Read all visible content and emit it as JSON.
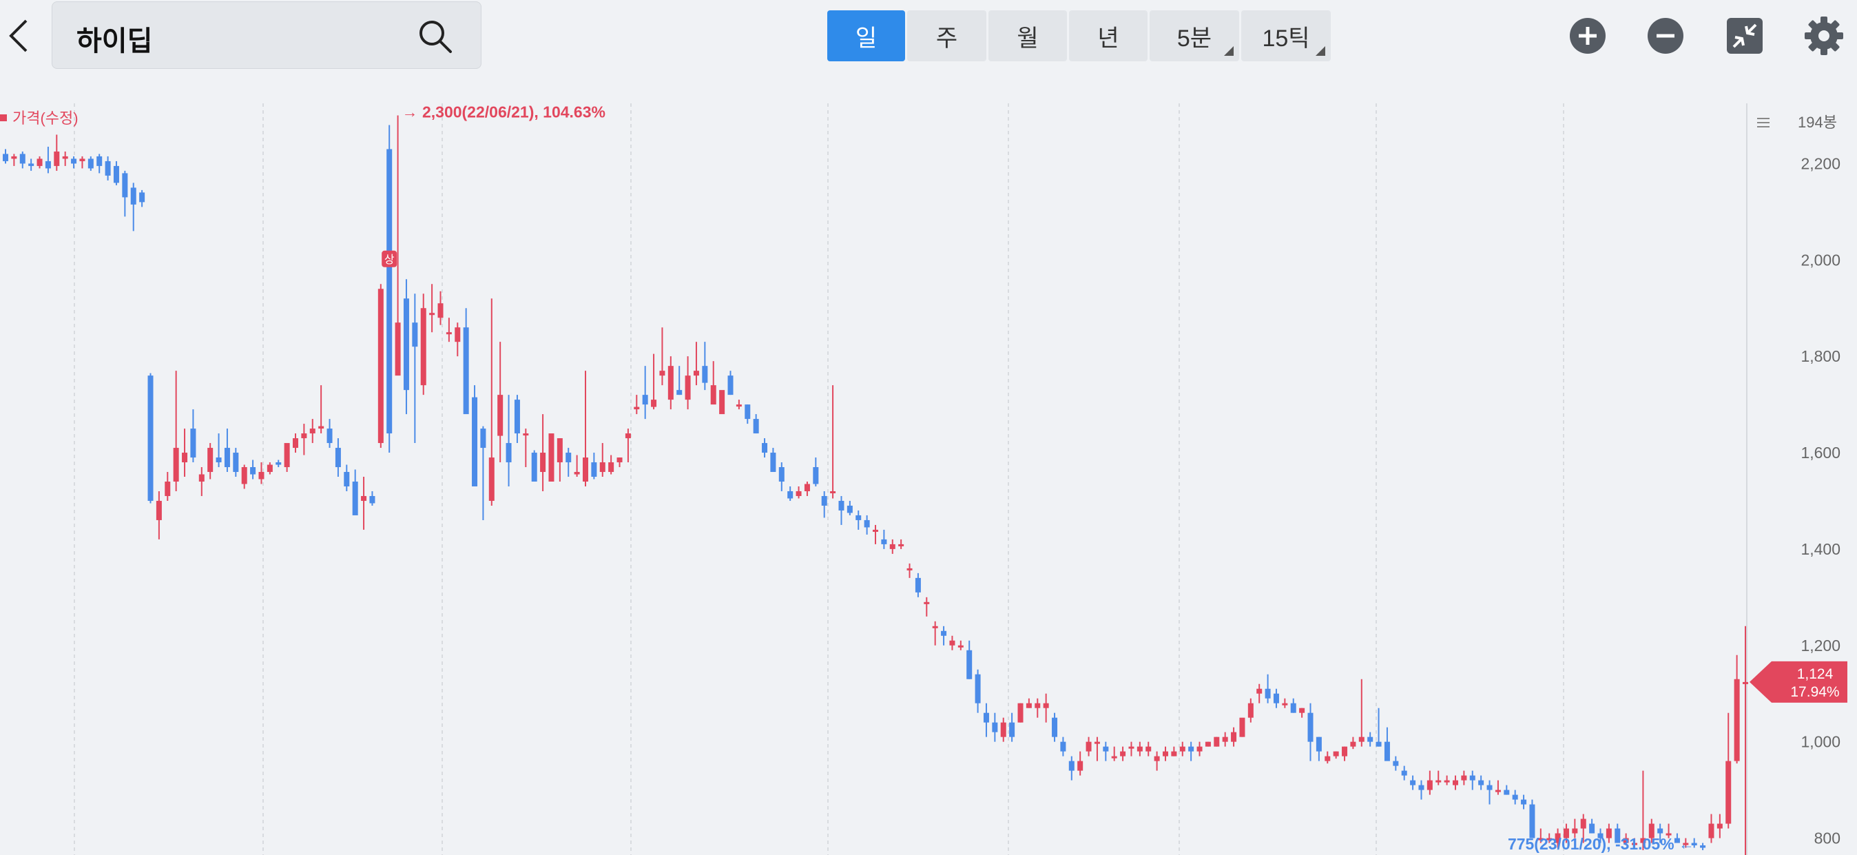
{
  "header": {
    "title": "하이딥",
    "tabs": [
      {
        "label": "일",
        "active": true,
        "dropdown": false
      },
      {
        "label": "주",
        "active": false,
        "dropdown": false
      },
      {
        "label": "월",
        "active": false,
        "dropdown": false
      },
      {
        "label": "년",
        "active": false,
        "dropdown": false
      },
      {
        "label": "5분",
        "active": false,
        "dropdown": true
      },
      {
        "label": "15틱",
        "active": false,
        "dropdown": true
      }
    ],
    "icons": [
      "chevron-left-icon",
      "search-icon",
      "zoom-in-icon",
      "zoom-out-icon",
      "collapse-icon",
      "gear-icon"
    ]
  },
  "colors": {
    "up": "#e2475d",
    "down": "#4b8be8",
    "accent": "#2f8bea"
  },
  "chart_data": {
    "type": "candlestick",
    "legend": "가격(수정)",
    "bar_count_label": "194봉",
    "y_ticks": [
      800,
      1000,
      1200,
      1400,
      1600,
      1800,
      2000,
      2200
    ],
    "ylim": [
      765,
      2325
    ],
    "grid": "vertical-dashed",
    "high_annotation": "→ 2,300(22/06/21), 104.63%",
    "low_annotation": "775(23/01/20), -31.05% ←",
    "upper_limit_badge": "상",
    "current_price": {
      "value": 1124,
      "label": "1,124",
      "change": "17.94%"
    },
    "candles": [
      [
        2220,
        2230,
        2200,
        2205
      ],
      [
        2210,
        2220,
        2195,
        2215
      ],
      [
        2220,
        2225,
        2190,
        2200
      ],
      [
        2200,
        2210,
        2185,
        2195
      ],
      [
        2195,
        2215,
        2190,
        2210
      ],
      [
        2205,
        2235,
        2180,
        2190
      ],
      [
        2195,
        2260,
        2185,
        2225
      ],
      [
        2210,
        2225,
        2195,
        2215
      ],
      [
        2210,
        2215,
        2190,
        2200
      ],
      [
        2205,
        2215,
        2190,
        2210
      ],
      [
        2210,
        2215,
        2185,
        2190
      ],
      [
        2215,
        2220,
        2180,
        2195
      ],
      [
        2205,
        2215,
        2165,
        2175
      ],
      [
        2195,
        2205,
        2155,
        2160
      ],
      [
        2180,
        2185,
        2090,
        2130
      ],
      [
        2150,
        2160,
        2060,
        2115
      ],
      [
        2140,
        2145,
        2110,
        2120
      ],
      [
        1760,
        1765,
        1495,
        1500
      ],
      [
        1460,
        1520,
        1420,
        1500
      ],
      [
        1510,
        1560,
        1500,
        1540
      ],
      [
        1540,
        1770,
        1520,
        1610
      ],
      [
        1580,
        1650,
        1550,
        1600
      ],
      [
        1650,
        1690,
        1580,
        1590
      ],
      [
        1540,
        1570,
        1510,
        1555
      ],
      [
        1560,
        1620,
        1545,
        1610
      ],
      [
        1590,
        1640,
        1570,
        1580
      ],
      [
        1610,
        1650,
        1560,
        1570
      ],
      [
        1600,
        1610,
        1550,
        1560
      ],
      [
        1535,
        1575,
        1525,
        1570
      ],
      [
        1570,
        1585,
        1545,
        1555
      ],
      [
        1545,
        1580,
        1535,
        1560
      ],
      [
        1560,
        1580,
        1555,
        1575
      ],
      [
        1580,
        1585,
        1570,
        1575
      ],
      [
        1570,
        1600,
        1560,
        1620
      ],
      [
        1610,
        1640,
        1600,
        1630
      ],
      [
        1630,
        1660,
        1595,
        1640
      ],
      [
        1640,
        1670,
        1620,
        1650
      ],
      [
        1650,
        1740,
        1640,
        1655
      ],
      [
        1650,
        1670,
        1610,
        1620
      ],
      [
        1610,
        1630,
        1550,
        1570
      ],
      [
        1560,
        1575,
        1520,
        1530
      ],
      [
        1540,
        1565,
        1490,
        1470
      ],
      [
        1500,
        1550,
        1440,
        1510
      ],
      [
        1510,
        1520,
        1490,
        1495
      ],
      [
        1620,
        1950,
        1610,
        1940
      ],
      [
        2230,
        2280,
        1600,
        1640
      ],
      [
        1760,
        2300,
        1780,
        1870
      ],
      [
        1920,
        1960,
        1680,
        1730
      ],
      [
        1870,
        1930,
        1620,
        1820
      ],
      [
        1740,
        1930,
        1720,
        1900
      ],
      [
        1890,
        1950,
        1850,
        1890
      ],
      [
        1880,
        1935,
        1865,
        1910
      ],
      [
        1850,
        1880,
        1830,
        1850
      ],
      [
        1830,
        1870,
        1800,
        1860
      ],
      [
        1860,
        1900,
        1690,
        1680
      ],
      [
        1715,
        1740,
        1530,
        1530
      ],
      [
        1650,
        1655,
        1460,
        1610
      ],
      [
        1500,
        1920,
        1490,
        1590
      ],
      [
        1635,
        1830,
        1580,
        1720
      ],
      [
        1620,
        1720,
        1530,
        1580
      ],
      [
        1710,
        1720,
        1620,
        1640
      ],
      [
        1640,
        1650,
        1570,
        1640
      ],
      [
        1600,
        1605,
        1540,
        1540
      ],
      [
        1560,
        1680,
        1520,
        1600
      ],
      [
        1540,
        1570,
        1560,
        1640
      ],
      [
        1580,
        1630,
        1540,
        1630
      ],
      [
        1600,
        1610,
        1550,
        1580
      ],
      [
        1555,
        1595,
        1550,
        1560
      ],
      [
        1540,
        1770,
        1530,
        1590
      ],
      [
        1580,
        1600,
        1545,
        1550
      ],
      [
        1560,
        1620,
        1550,
        1580
      ],
      [
        1560,
        1595,
        1555,
        1580
      ],
      [
        1580,
        1590,
        1570,
        1590
      ],
      [
        1630,
        1650,
        1580,
        1640
      ],
      [
        1690,
        1720,
        1680,
        1695
      ],
      [
        1720,
        1780,
        1670,
        1700
      ],
      [
        1695,
        1805,
        1690,
        1710
      ],
      [
        1760,
        1860,
        1740,
        1770
      ],
      [
        1710,
        1800,
        1690,
        1780
      ],
      [
        1730,
        1780,
        1720,
        1720
      ],
      [
        1710,
        1800,
        1690,
        1760
      ],
      [
        1760,
        1830,
        1740,
        1770
      ],
      [
        1780,
        1830,
        1730,
        1745
      ],
      [
        1700,
        1790,
        1720,
        1740
      ],
      [
        1680,
        1700,
        1690,
        1730
      ],
      [
        1760,
        1770,
        1720,
        1720
      ],
      [
        1700,
        1710,
        1690,
        1700
      ],
      [
        1700,
        1700,
        1660,
        1670
      ],
      [
        1670,
        1680,
        1640,
        1640
      ],
      [
        1620,
        1630,
        1590,
        1600
      ],
      [
        1600,
        1610,
        1560,
        1560
      ],
      [
        1570,
        1580,
        1520,
        1540
      ],
      [
        1520,
        1530,
        1500,
        1505
      ],
      [
        1510,
        1530,
        1505,
        1520
      ],
      [
        1520,
        1540,
        1510,
        1535
      ],
      [
        1570,
        1590,
        1530,
        1535
      ],
      [
        1510,
        1520,
        1465,
        1490
      ],
      [
        1520,
        1740,
        1505,
        1520
      ],
      [
        1500,
        1510,
        1450,
        1480
      ],
      [
        1490,
        1500,
        1470,
        1475
      ],
      [
        1470,
        1480,
        1440,
        1460
      ],
      [
        1460,
        1470,
        1430,
        1445
      ],
      [
        1440,
        1450,
        1410,
        1440
      ],
      [
        1420,
        1440,
        1400,
        1410
      ],
      [
        1400,
        1420,
        1390,
        1410
      ],
      [
        1410,
        1420,
        1400,
        1410
      ],
      [
        1360,
        1370,
        1340,
        1360
      ],
      [
        1340,
        1350,
        1300,
        1310
      ],
      [
        1290,
        1300,
        1260,
        1290
      ],
      [
        1240,
        1250,
        1200,
        1240
      ],
      [
        1230,
        1240,
        1200,
        1220
      ],
      [
        1200,
        1220,
        1190,
        1210
      ],
      [
        1200,
        1210,
        1190,
        1200
      ],
      [
        1190,
        1210,
        1130,
        1130
      ],
      [
        1140,
        1150,
        1060,
        1080
      ],
      [
        1060,
        1080,
        1010,
        1040
      ],
      [
        1040,
        1060,
        1000,
        1020
      ],
      [
        1010,
        1050,
        1000,
        1040
      ],
      [
        1040,
        1060,
        1000,
        1010
      ],
      [
        1040,
        1080,
        1040,
        1080
      ],
      [
        1070,
        1090,
        1070,
        1080
      ],
      [
        1070,
        1090,
        1050,
        1080
      ],
      [
        1070,
        1100,
        1040,
        1080
      ],
      [
        1050,
        1060,
        1000,
        1010
      ],
      [
        1000,
        1010,
        970,
        980
      ],
      [
        960,
        970,
        920,
        940
      ],
      [
        940,
        980,
        930,
        960
      ],
      [
        980,
        1010,
        970,
        1000
      ],
      [
        1000,
        1010,
        960,
        1000
      ],
      [
        990,
        1000,
        960,
        980
      ],
      [
        970,
        990,
        960,
        970
      ],
      [
        970,
        990,
        960,
        980
      ],
      [
        990,
        1000,
        970,
        990
      ],
      [
        980,
        1000,
        970,
        990
      ],
      [
        980,
        1000,
        970,
        990
      ],
      [
        960,
        980,
        940,
        970
      ],
      [
        970,
        990,
        960,
        980
      ],
      [
        970,
        990,
        970,
        980
      ],
      [
        980,
        1000,
        970,
        990
      ],
      [
        990,
        1000,
        960,
        980
      ],
      [
        980,
        1000,
        970,
        990
      ],
      [
        990,
        1000,
        990,
        1000
      ],
      [
        990,
        1010,
        990,
        1010
      ],
      [
        1000,
        1020,
        990,
        1010
      ],
      [
        1000,
        1030,
        990,
        1020
      ],
      [
        1010,
        1040,
        1010,
        1050
      ],
      [
        1050,
        1090,
        1040,
        1080
      ],
      [
        1100,
        1120,
        1080,
        1110
      ],
      [
        1110,
        1140,
        1080,
        1090
      ],
      [
        1100,
        1110,
        1070,
        1080
      ],
      [
        1080,
        1090,
        1070,
        1080
      ],
      [
        1080,
        1090,
        1060,
        1060
      ],
      [
        1060,
        1070,
        1050,
        1070
      ],
      [
        1060,
        1080,
        960,
        1000
      ],
      [
        1010,
        1010,
        960,
        980
      ],
      [
        960,
        980,
        955,
        970
      ],
      [
        970,
        980,
        965,
        980
      ],
      [
        970,
        990,
        960,
        990
      ],
      [
        990,
        1010,
        985,
        1000
      ],
      [
        1000,
        1130,
        990,
        1010
      ],
      [
        1010,
        1020,
        990,
        1000
      ],
      [
        1000,
        1070,
        990,
        990
      ],
      [
        1000,
        1030,
        990,
        960
      ],
      [
        960,
        970,
        940,
        950
      ],
      [
        940,
        950,
        920,
        930
      ],
      [
        920,
        930,
        900,
        910
      ],
      [
        910,
        920,
        880,
        900
      ],
      [
        900,
        940,
        890,
        920
      ],
      [
        920,
        940,
        910,
        920
      ],
      [
        920,
        930,
        910,
        920
      ],
      [
        910,
        930,
        900,
        920
      ],
      [
        920,
        940,
        910,
        930
      ],
      [
        930,
        940,
        900,
        920
      ],
      [
        920,
        930,
        900,
        910
      ],
      [
        910,
        920,
        870,
        900
      ],
      [
        900,
        920,
        890,
        900
      ],
      [
        900,
        910,
        890,
        890
      ],
      [
        890,
        900,
        870,
        880
      ],
      [
        880,
        890,
        860,
        870
      ],
      [
        870,
        880,
        820,
        800
      ],
      [
        800,
        820,
        790,
        800
      ],
      [
        800,
        810,
        790,
        800
      ],
      [
        790,
        820,
        780,
        810
      ],
      [
        800,
        830,
        790,
        820
      ],
      [
        810,
        840,
        800,
        820
      ],
      [
        820,
        850,
        790,
        840
      ],
      [
        830,
        840,
        810,
        810
      ],
      [
        810,
        820,
        790,
        800
      ],
      [
        800,
        830,
        790,
        820
      ],
      [
        820,
        830,
        790,
        790
      ],
      [
        790,
        810,
        785,
        800
      ],
      [
        790,
        800,
        780,
        790
      ],
      [
        790,
        940,
        775,
        800
      ],
      [
        800,
        840,
        790,
        830
      ],
      [
        820,
        830,
        790,
        810
      ],
      [
        810,
        830,
        800,
        810
      ],
      [
        800,
        810,
        790,
        790
      ],
      [
        790,
        800,
        780,
        790
      ],
      [
        790,
        800,
        780,
        785
      ],
      [
        785,
        790,
        775,
        780
      ],
      [
        800,
        850,
        790,
        830
      ],
      [
        820,
        850,
        800,
        830
      ],
      [
        830,
        1060,
        820,
        960
      ],
      [
        960,
        1180,
        955,
        1130
      ],
      [
        1124,
        1240,
        765,
        1124
      ]
    ]
  }
}
